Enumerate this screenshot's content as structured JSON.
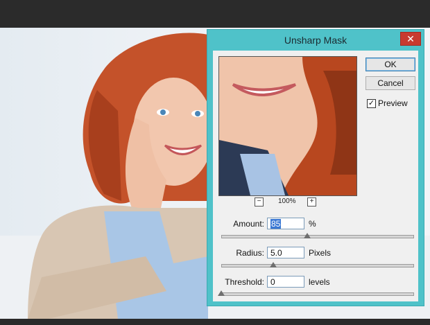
{
  "dialog": {
    "title": "Unsharp Mask",
    "close_glyph": "✕",
    "ok_label": "OK",
    "cancel_label": "Cancel",
    "preview_label": "Preview",
    "preview_checked": true,
    "zoom": {
      "value": "100%",
      "minus_glyph": "−",
      "plus_glyph": "+"
    },
    "amount": {
      "label": "Amount:",
      "value": "85",
      "unit": "%",
      "slider_fraction": 0.45
    },
    "radius": {
      "label": "Radius:",
      "value": "5.0",
      "unit": "Pixels",
      "slider_fraction": 0.27
    },
    "threshold": {
      "label": "Threshold:",
      "value": "0",
      "unit": "levels",
      "slider_fraction": 0.0
    }
  },
  "colors": {
    "window_frame": "#4fc2c9",
    "close_button": "#c83a2f",
    "selection": "#3a78d4"
  }
}
